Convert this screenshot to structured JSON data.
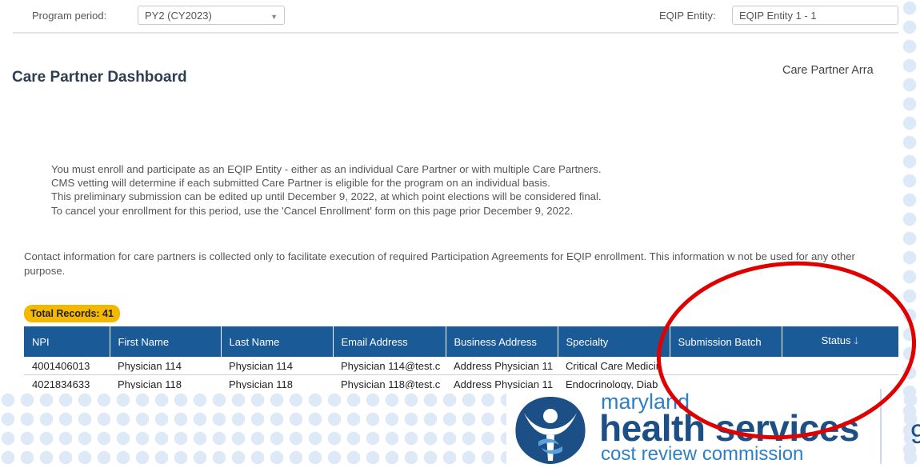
{
  "header": {
    "program_period_label": "Program period:",
    "program_period_value": "PY2 (CY2023)",
    "entity_label": "EQIP Entity:",
    "entity_value": "EQIP Entity 1 - 1"
  },
  "page": {
    "title": "Care Partner Dashboard",
    "arrangement_link": "Care Partner Arra"
  },
  "bullets": [
    "You must enroll and participate as an EQIP Entity - either as an individual Care Partner or with multiple Care Partners.",
    "CMS vetting will determine if each submitted Care Partner is eligible for the program on an individual basis.",
    "This preliminary submission can be edited up until December 9, 2022, at which point elections will be considered final.",
    "To cancel your enrollment for this period, use the 'Cancel Enrollment' form on this page prior December 9, 2022."
  ],
  "contact_note": "Contact information for care partners is collected only to facilitate execution of required Participation Agreements for EQIP enrollment. This information w not be used for any other purpose.",
  "table": {
    "total_records": "Total Records: 41",
    "columns": [
      "NPI",
      "First Name",
      "Last Name",
      "Email Address",
      "Business Address",
      "Specialty",
      "Submission Batch",
      "Status"
    ],
    "rows": [
      [
        "4001406013",
        "Physician 114",
        "Physician 114",
        "Physician 114@test.c",
        "Address Physician 11",
        "Critical Care Medicin",
        "",
        ""
      ],
      [
        "4021834633",
        "Physician 118",
        "Physician 118",
        "Physician 118@test.c",
        "Address Physician 11",
        "Endocrinology, Diab",
        "",
        ""
      ]
    ]
  },
  "footer": {
    "logo_line1": "maryland",
    "logo_line2": "health services",
    "logo_line3": "cost review commission",
    "page_number": "9"
  },
  "colors": {
    "table_header": "#1a5a96",
    "badge": "#f5b800",
    "annotation": "#e00000",
    "brand_dark": "#1c4f85",
    "brand_light": "#2f7fc4"
  }
}
